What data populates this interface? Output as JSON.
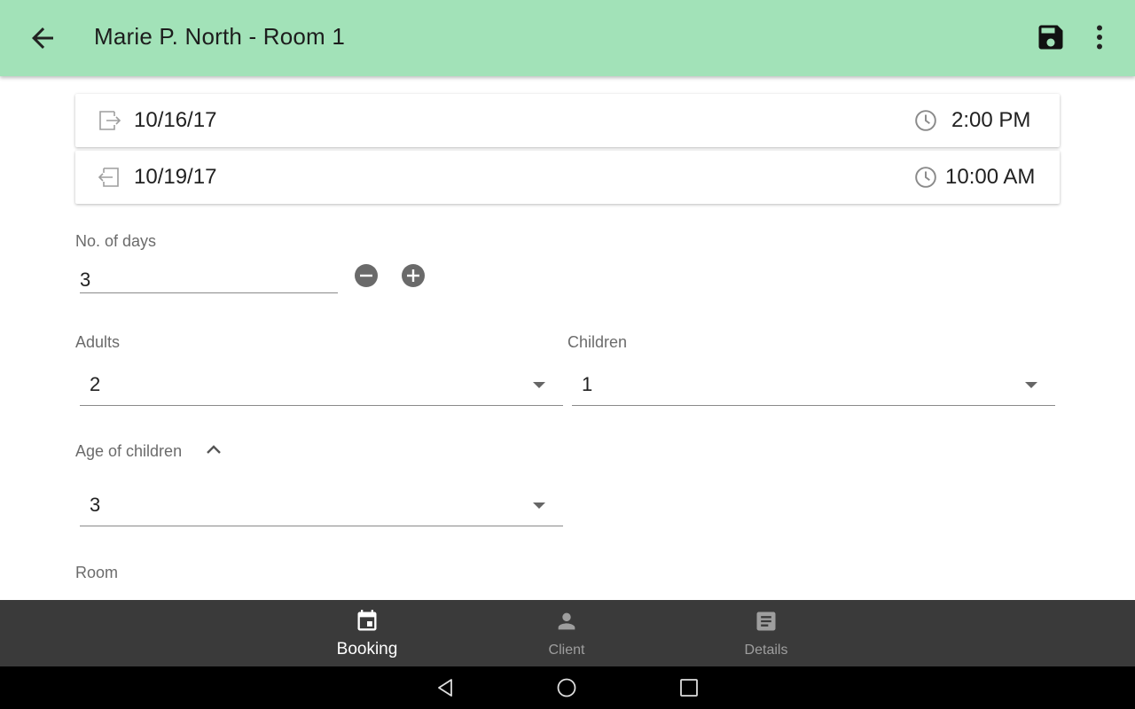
{
  "appbar": {
    "title": "Marie P. North - Room 1",
    "back_icon": "arrow-back-icon",
    "save_icon": "save-icon",
    "more_icon": "more-vert-icon",
    "background_color": "#a2e2b8"
  },
  "checkin": {
    "date": "10/16/17",
    "time": "2:00 PM",
    "icon": "login-icon"
  },
  "checkout": {
    "date": "10/19/17",
    "time": "10:00 AM",
    "icon": "logout-icon"
  },
  "days": {
    "label": "No. of days",
    "value": "3"
  },
  "adults": {
    "label": "Adults",
    "value": "2"
  },
  "children": {
    "label": "Children",
    "value": "1"
  },
  "age_of_children": {
    "label": "Age of children",
    "values": [
      "3"
    ]
  },
  "room": {
    "label": "Room"
  },
  "bottom_nav": {
    "items": [
      {
        "label": "Booking",
        "icon": "calendar-event-icon",
        "active": true
      },
      {
        "label": "Client",
        "icon": "person-icon",
        "active": false
      },
      {
        "label": "Details",
        "icon": "document-icon",
        "active": false
      }
    ]
  },
  "system_nav": {
    "back": "back-triangle-icon",
    "home": "home-circle-icon",
    "recents": "recents-square-icon"
  }
}
